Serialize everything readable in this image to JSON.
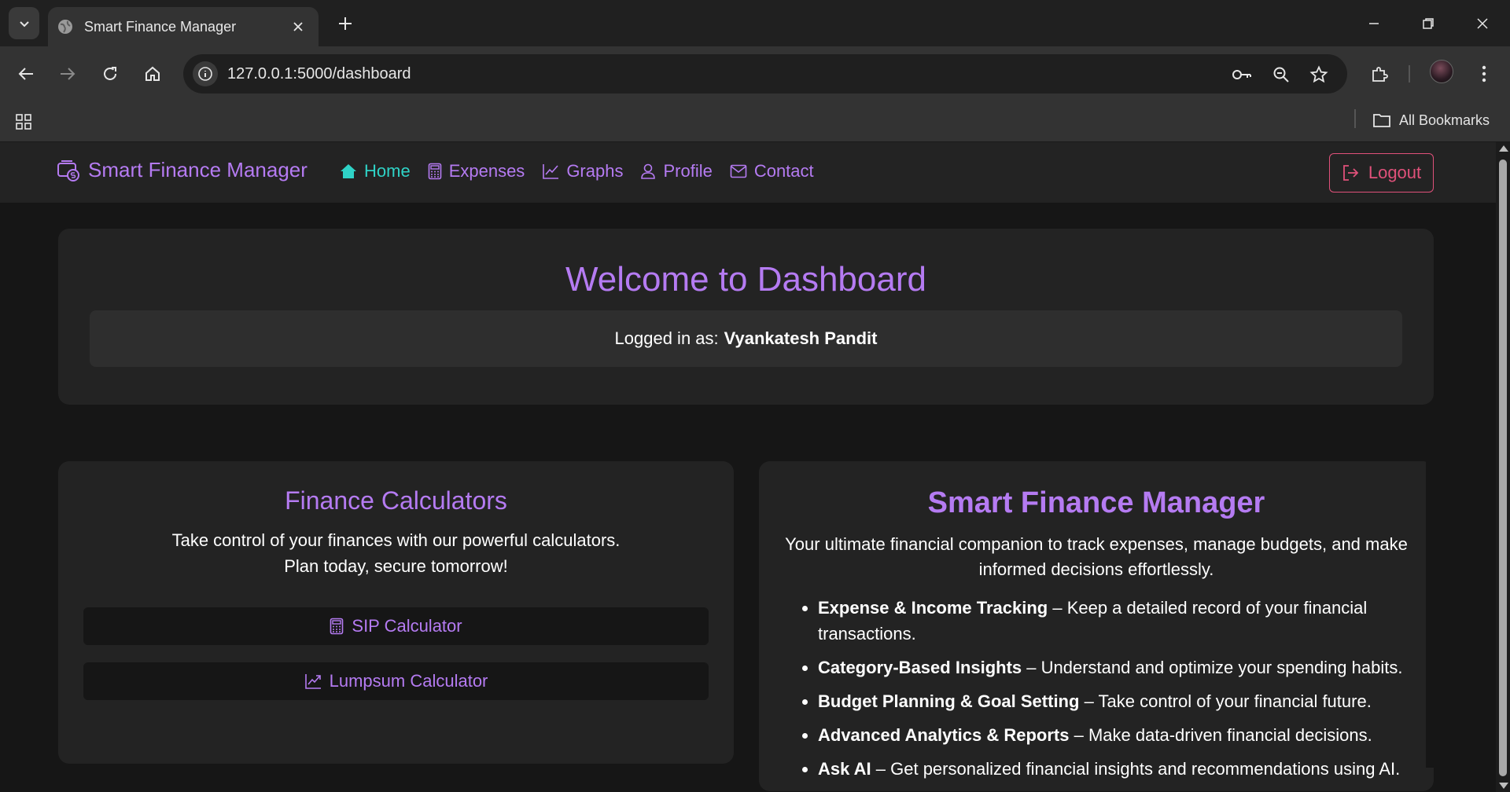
{
  "browser": {
    "tab_title": "Smart Finance Manager",
    "url": "127.0.0.1:5000/dashboard",
    "all_bookmarks_label": "All Bookmarks"
  },
  "navbar": {
    "brand": "Smart Finance Manager",
    "links": [
      {
        "label": "Home",
        "icon": "home-icon",
        "active": true
      },
      {
        "label": "Expenses",
        "icon": "calculator-icon",
        "active": false
      },
      {
        "label": "Graphs",
        "icon": "chart-line-icon",
        "active": false
      },
      {
        "label": "Profile",
        "icon": "person-icon",
        "active": false
      },
      {
        "label": "Contact",
        "icon": "envelope-icon",
        "active": false
      }
    ],
    "logout_label": "Logout"
  },
  "welcome": {
    "title": "Welcome to Dashboard",
    "logged_in_label": "Logged in as:",
    "username": "Vyankatesh Pandit"
  },
  "calculators": {
    "title": "Finance Calculators",
    "description_line1": "Take control of your finances with our powerful calculators.",
    "description_line2": "Plan today, secure tomorrow!",
    "buttons": [
      {
        "label": "SIP Calculator",
        "icon": "calculator-icon"
      },
      {
        "label": "Lumpsum Calculator",
        "icon": "chart-line-icon"
      }
    ]
  },
  "about": {
    "title": "Smart Finance Manager",
    "description": "Your ultimate financial companion to track expenses, manage budgets, and make informed decisions effortlessly.",
    "features": [
      {
        "bold": "Expense & Income Tracking",
        "text": " – Keep a detailed record of your financial transactions."
      },
      {
        "bold": "Category-Based Insights",
        "text": " – Understand and optimize your spending habits."
      },
      {
        "bold": "Budget Planning & Goal Setting",
        "text": " – Take control of your financial future."
      },
      {
        "bold": "Advanced Analytics & Reports",
        "text": " – Make data-driven financial decisions."
      },
      {
        "bold": "Ask AI",
        "text": " – Get personalized financial insights and recommendations using AI."
      }
    ]
  },
  "colors": {
    "accent_purple": "#b57bf2",
    "active_teal": "#2fd3c7",
    "logout_pink": "#e0517a",
    "card_bg": "#232323",
    "page_bg": "#161616"
  }
}
